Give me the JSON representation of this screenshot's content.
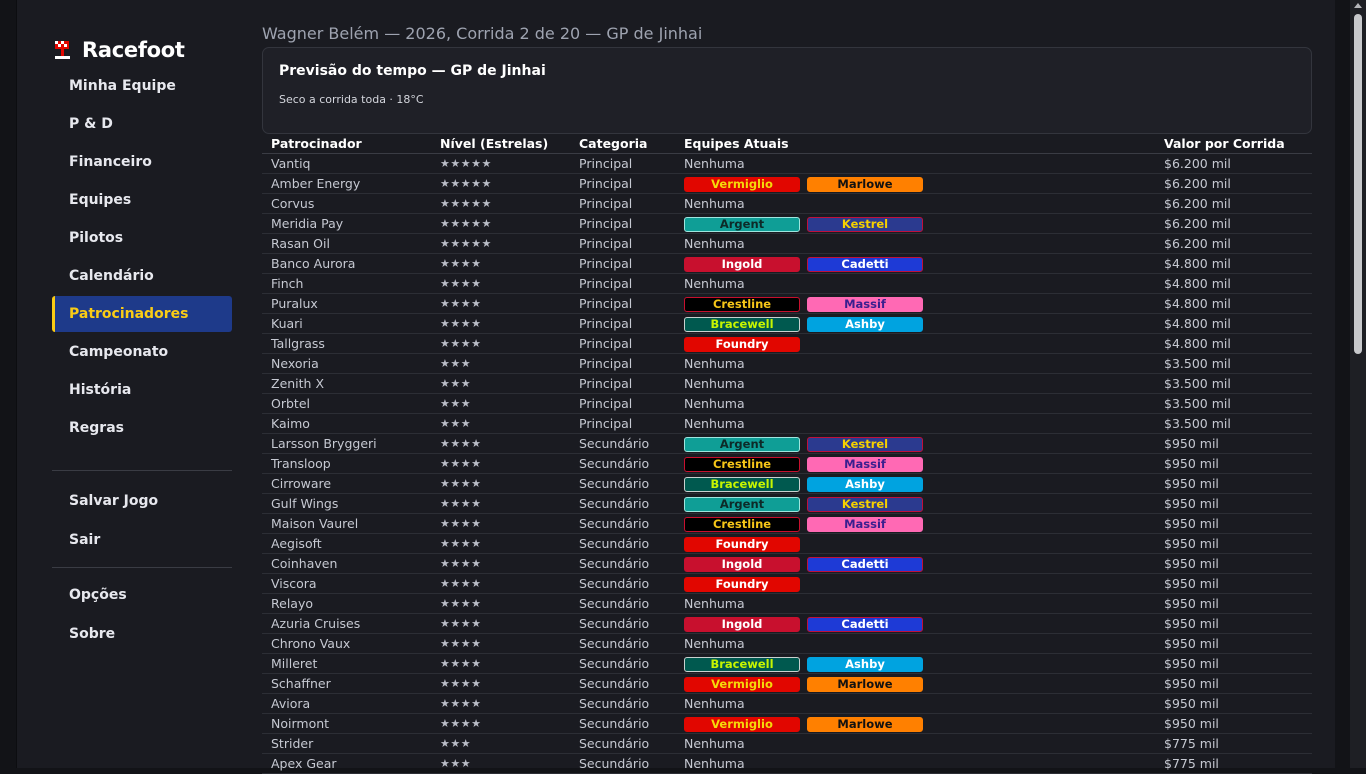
{
  "app": {
    "name": "Racefoot"
  },
  "nav": {
    "items": [
      {
        "label": "Minha Equipe",
        "active": false
      },
      {
        "label": "P & D",
        "active": false
      },
      {
        "label": "Financeiro",
        "active": false
      },
      {
        "label": "Equipes",
        "active": false
      },
      {
        "label": "Pilotos",
        "active": false
      },
      {
        "label": "Calendário",
        "active": false
      },
      {
        "label": "Patrocinadores",
        "active": true
      },
      {
        "label": "Campeonato",
        "active": false
      },
      {
        "label": "História",
        "active": false
      },
      {
        "label": "Regras",
        "active": false
      }
    ],
    "save": "Salvar Jogo",
    "exit": "Sair",
    "options": "Opções",
    "about": "Sobre"
  },
  "header": {
    "breadcrumb": "Wagner Belém — 2026, Corrida 2 de 20 — GP de Jinhai"
  },
  "weather": {
    "title": "Previsão do tempo — GP de Jinhai",
    "detail": "Seco a corrida toda · 18°C"
  },
  "table": {
    "headers": [
      "Patrocinador",
      "Nível (Estrelas)",
      "Categoria",
      "Equipes Atuais",
      "Valor por Corrida"
    ],
    "none_label": "Nenhuma",
    "rows": [
      {
        "name": "Vantiq",
        "stars": 5,
        "category": "Principal",
        "teams": [],
        "value": "$6.200 mil"
      },
      {
        "name": "Amber Energy",
        "stars": 5,
        "category": "Principal",
        "teams": [
          "Vermiglio",
          "Marlowe"
        ],
        "value": "$6.200 mil"
      },
      {
        "name": "Corvus",
        "stars": 5,
        "category": "Principal",
        "teams": [],
        "value": "$6.200 mil"
      },
      {
        "name": "Meridia Pay",
        "stars": 5,
        "category": "Principal",
        "teams": [
          "Argent",
          "Kestrel"
        ],
        "value": "$6.200 mil"
      },
      {
        "name": "Rasan Oil",
        "stars": 5,
        "category": "Principal",
        "teams": [],
        "value": "$6.200 mil"
      },
      {
        "name": "Banco Aurora",
        "stars": 4,
        "category": "Principal",
        "teams": [
          "Ingold",
          "Cadetti"
        ],
        "value": "$4.800 mil"
      },
      {
        "name": "Finch",
        "stars": 4,
        "category": "Principal",
        "teams": [],
        "value": "$4.800 mil"
      },
      {
        "name": "Puralux",
        "stars": 4,
        "category": "Principal",
        "teams": [
          "Crestline",
          "Massif"
        ],
        "value": "$4.800 mil"
      },
      {
        "name": "Kuari",
        "stars": 4,
        "category": "Principal",
        "teams": [
          "Bracewell",
          "Ashby"
        ],
        "value": "$4.800 mil"
      },
      {
        "name": "Tallgrass",
        "stars": 4,
        "category": "Principal",
        "teams": [
          "Foundry"
        ],
        "value": "$4.800 mil"
      },
      {
        "name": "Nexoria",
        "stars": 3,
        "category": "Principal",
        "teams": [],
        "value": "$3.500 mil"
      },
      {
        "name": "Zenith X",
        "stars": 3,
        "category": "Principal",
        "teams": [],
        "value": "$3.500 mil"
      },
      {
        "name": "Orbtel",
        "stars": 3,
        "category": "Principal",
        "teams": [],
        "value": "$3.500 mil"
      },
      {
        "name": "Kaimo",
        "stars": 3,
        "category": "Principal",
        "teams": [],
        "value": "$3.500 mil"
      },
      {
        "name": "Larsson Bryggeri",
        "stars": 4,
        "category": "Secundário",
        "teams": [
          "Argent",
          "Kestrel"
        ],
        "value": "$950 mil"
      },
      {
        "name": "Transloop",
        "stars": 4,
        "category": "Secundário",
        "teams": [
          "Crestline",
          "Massif"
        ],
        "value": "$950 mil"
      },
      {
        "name": "Cirroware",
        "stars": 4,
        "category": "Secundário",
        "teams": [
          "Bracewell",
          "Ashby"
        ],
        "value": "$950 mil"
      },
      {
        "name": "Gulf Wings",
        "stars": 4,
        "category": "Secundário",
        "teams": [
          "Argent",
          "Kestrel"
        ],
        "value": "$950 mil"
      },
      {
        "name": "Maison Vaurel",
        "stars": 4,
        "category": "Secundário",
        "teams": [
          "Crestline",
          "Massif"
        ],
        "value": "$950 mil"
      },
      {
        "name": "Aegisoft",
        "stars": 4,
        "category": "Secundário",
        "teams": [
          "Foundry"
        ],
        "value": "$950 mil"
      },
      {
        "name": "Coinhaven",
        "stars": 4,
        "category": "Secundário",
        "teams": [
          "Ingold",
          "Cadetti"
        ],
        "value": "$950 mil"
      },
      {
        "name": "Viscora",
        "stars": 4,
        "category": "Secundário",
        "teams": [
          "Foundry"
        ],
        "value": "$950 mil"
      },
      {
        "name": "Relayo",
        "stars": 4,
        "category": "Secundário",
        "teams": [],
        "value": "$950 mil"
      },
      {
        "name": "Azuria Cruises",
        "stars": 4,
        "category": "Secundário",
        "teams": [
          "Ingold",
          "Cadetti"
        ],
        "value": "$950 mil"
      },
      {
        "name": "Chrono Vaux",
        "stars": 4,
        "category": "Secundário",
        "teams": [],
        "value": "$950 mil"
      },
      {
        "name": "Milleret",
        "stars": 4,
        "category": "Secundário",
        "teams": [
          "Bracewell",
          "Ashby"
        ],
        "value": "$950 mil"
      },
      {
        "name": "Schaffner",
        "stars": 4,
        "category": "Secundário",
        "teams": [
          "Vermiglio",
          "Marlowe"
        ],
        "value": "$950 mil"
      },
      {
        "name": "Aviora",
        "stars": 4,
        "category": "Secundário",
        "teams": [],
        "value": "$950 mil"
      },
      {
        "name": "Noirmont",
        "stars": 4,
        "category": "Secundário",
        "teams": [
          "Vermiglio",
          "Marlowe"
        ],
        "value": "$950 mil"
      },
      {
        "name": "Strider",
        "stars": 3,
        "category": "Secundário",
        "teams": [],
        "value": "$775 mil"
      },
      {
        "name": "Apex Gear",
        "stars": 3,
        "category": "Secundário",
        "teams": [],
        "value": "$775 mil"
      }
    ]
  },
  "team_colors": {
    "Vermiglio": {
      "bg": "#e10600",
      "fg": "#f5d90a",
      "border": "#e10600"
    },
    "Marlowe": {
      "bg": "#ff8000",
      "fg": "#111111",
      "border": "#ff8000"
    },
    "Argent": {
      "bg": "#0f9e96",
      "fg": "#0d2a28",
      "border": "#9fe6df"
    },
    "Kestrel": {
      "bg": "#2b3a8f",
      "fg": "#f5d000",
      "border": "#c0103c"
    },
    "Ingold": {
      "bg": "#c8102e",
      "fg": "#ffffff",
      "border": "#c8102e"
    },
    "Cadetti": {
      "bg": "#1e3ad6",
      "fg": "#ffffff",
      "border": "#c0103c"
    },
    "Crestline": {
      "bg": "#000000",
      "fg": "#f5c518",
      "border": "#c8102e"
    },
    "Massif": {
      "bg": "#ff69b4",
      "fg": "#3a1f8f",
      "border": "#ff69b4"
    },
    "Bracewell": {
      "bg": "#00594f",
      "fg": "#c6f500",
      "border": "#c9d1d0"
    },
    "Ashby": {
      "bg": "#00a3e0",
      "fg": "#ffffff",
      "border": "#00a3e0"
    },
    "Foundry": {
      "bg": "#e10600",
      "fg": "#ffffff",
      "border": "#e10600"
    }
  }
}
